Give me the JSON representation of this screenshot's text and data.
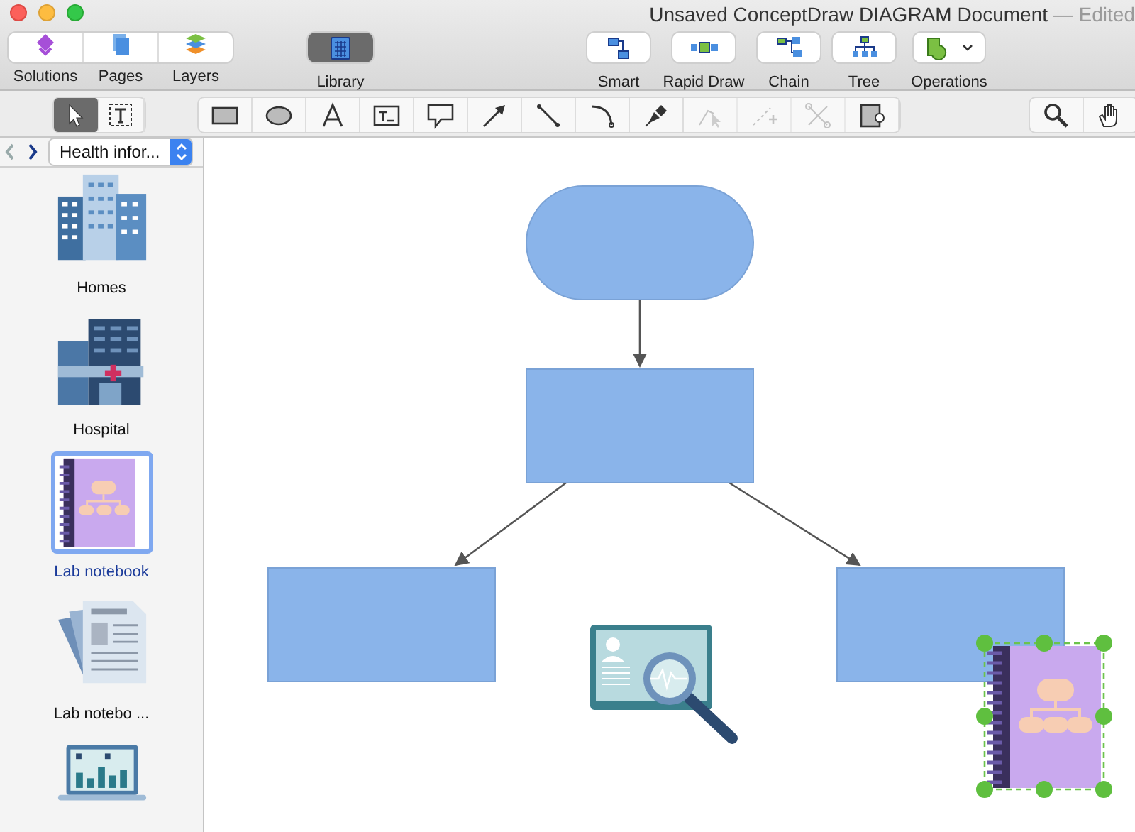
{
  "window": {
    "title": "Unsaved ConceptDraw DIAGRAM Document",
    "status": "— Edited"
  },
  "toolbar": {
    "left_group": [
      {
        "label": "Solutions",
        "kind": "solutions"
      },
      {
        "label": "Pages",
        "kind": "pages"
      },
      {
        "label": "Layers",
        "kind": "layers"
      }
    ],
    "library": {
      "label": "Library",
      "selected": true
    },
    "right_group": [
      {
        "label": "Smart",
        "kind": "smart"
      },
      {
        "label": "Rapid Draw",
        "kind": "rapid"
      },
      {
        "label": "Chain",
        "kind": "chain"
      },
      {
        "label": "Tree",
        "kind": "tree"
      },
      {
        "label": "Operations",
        "kind": "operations"
      }
    ]
  },
  "tools": {
    "mode": [
      {
        "kind": "pointer",
        "selected": true
      },
      {
        "kind": "text-select",
        "selected": false
      }
    ],
    "drawing": [
      {
        "kind": "rectangle",
        "disabled": false
      },
      {
        "kind": "ellipse",
        "disabled": false
      },
      {
        "kind": "text",
        "disabled": false
      },
      {
        "kind": "textbox",
        "disabled": false
      },
      {
        "kind": "callout",
        "disabled": false
      },
      {
        "kind": "arrow",
        "disabled": false
      },
      {
        "kind": "line",
        "disabled": false
      },
      {
        "kind": "arc",
        "disabled": false
      },
      {
        "kind": "pen",
        "disabled": false
      },
      {
        "kind": "point-select",
        "disabled": true
      },
      {
        "kind": "add-point",
        "disabled": true
      },
      {
        "kind": "cut-point",
        "disabled": true
      },
      {
        "kind": "insert",
        "disabled": false
      }
    ],
    "view": [
      {
        "kind": "zoom"
      },
      {
        "kind": "hand"
      }
    ]
  },
  "sidebar": {
    "library_select": "Health infor...",
    "items": [
      {
        "label": "Homes",
        "kind": "homes",
        "selected": false
      },
      {
        "label": "Hospital",
        "kind": "hospital",
        "selected": false
      },
      {
        "label": "Lab notebook",
        "kind": "notebook",
        "selected": true
      },
      {
        "label": "Lab notebo ...",
        "kind": "papers",
        "selected": false
      },
      {
        "kind": "laptop",
        "selected": false
      }
    ]
  },
  "canvas": {
    "shapes": [
      {
        "kind": "terminator",
        "selected": false
      },
      {
        "kind": "process",
        "selected": false
      },
      {
        "kind": "process",
        "selected": false
      },
      {
        "kind": "process",
        "selected": false
      },
      {
        "kind": "monitor",
        "selected": false
      },
      {
        "kind": "notebook",
        "selected": true
      }
    ]
  }
}
